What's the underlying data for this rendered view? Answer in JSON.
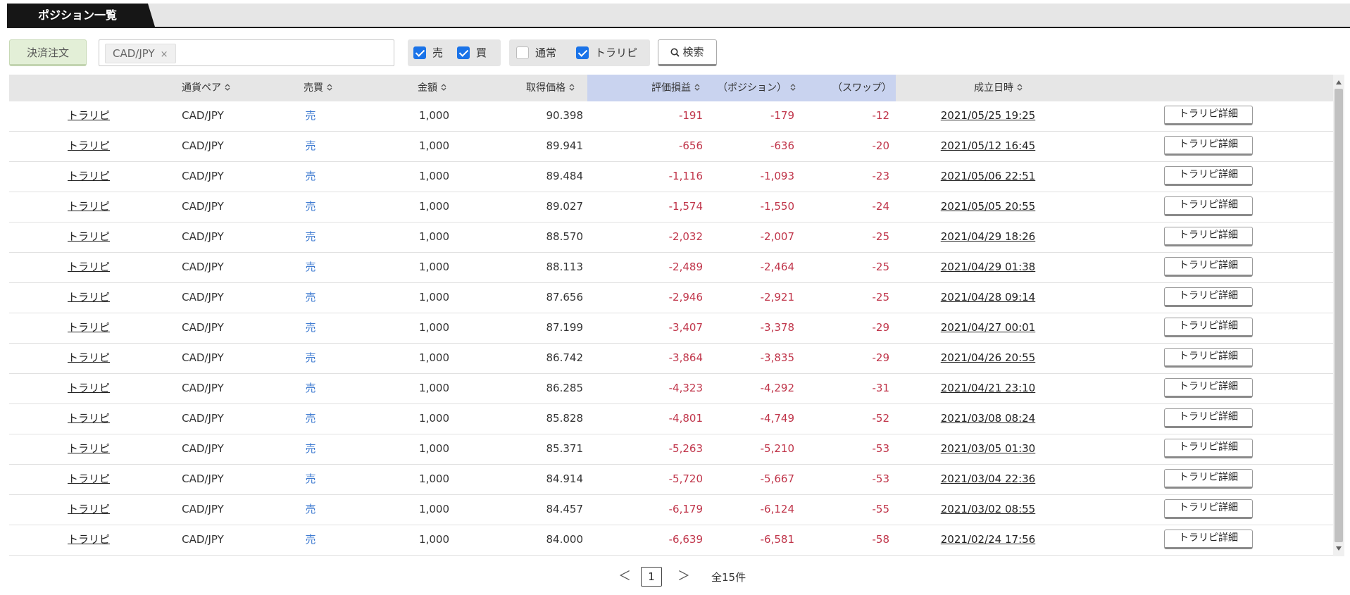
{
  "tab": {
    "title": "ポジション一覧"
  },
  "filters": {
    "settle_button": "決済注文",
    "pair_chip": "CAD/JPY",
    "chip_remove": "×",
    "side": [
      {
        "label": "売",
        "checked": true
      },
      {
        "label": "買",
        "checked": true
      }
    ],
    "order_type": [
      {
        "label": "通常",
        "checked": false
      },
      {
        "label": "トラリピ",
        "checked": true
      }
    ],
    "search_button": "検索"
  },
  "table": {
    "headers": {
      "pair": "通貨ペア",
      "side": "売買",
      "amount": "金額",
      "price": "取得価格",
      "pl": "評価損益",
      "position": "（ポジション）",
      "swap": "（スワップ）",
      "date": "成立日時"
    },
    "detail_button_label": "トラリピ詳細",
    "rows": [
      {
        "type": "トラリピ",
        "pair": "CAD/JPY",
        "side": "売",
        "amount": "1,000",
        "price": "90.398",
        "pl": "-191",
        "position": "-179",
        "swap": "-12",
        "date": "2021/05/25 19:25"
      },
      {
        "type": "トラリピ",
        "pair": "CAD/JPY",
        "side": "売",
        "amount": "1,000",
        "price": "89.941",
        "pl": "-656",
        "position": "-636",
        "swap": "-20",
        "date": "2021/05/12 16:45"
      },
      {
        "type": "トラリピ",
        "pair": "CAD/JPY",
        "side": "売",
        "amount": "1,000",
        "price": "89.484",
        "pl": "-1,116",
        "position": "-1,093",
        "swap": "-23",
        "date": "2021/05/06 22:51"
      },
      {
        "type": "トラリピ",
        "pair": "CAD/JPY",
        "side": "売",
        "amount": "1,000",
        "price": "89.027",
        "pl": "-1,574",
        "position": "-1,550",
        "swap": "-24",
        "date": "2021/05/05 20:55"
      },
      {
        "type": "トラリピ",
        "pair": "CAD/JPY",
        "side": "売",
        "amount": "1,000",
        "price": "88.570",
        "pl": "-2,032",
        "position": "-2,007",
        "swap": "-25",
        "date": "2021/04/29 18:26"
      },
      {
        "type": "トラリピ",
        "pair": "CAD/JPY",
        "side": "売",
        "amount": "1,000",
        "price": "88.113",
        "pl": "-2,489",
        "position": "-2,464",
        "swap": "-25",
        "date": "2021/04/29 01:38"
      },
      {
        "type": "トラリピ",
        "pair": "CAD/JPY",
        "side": "売",
        "amount": "1,000",
        "price": "87.656",
        "pl": "-2,946",
        "position": "-2,921",
        "swap": "-25",
        "date": "2021/04/28 09:14"
      },
      {
        "type": "トラリピ",
        "pair": "CAD/JPY",
        "side": "売",
        "amount": "1,000",
        "price": "87.199",
        "pl": "-3,407",
        "position": "-3,378",
        "swap": "-29",
        "date": "2021/04/27 00:01"
      },
      {
        "type": "トラリピ",
        "pair": "CAD/JPY",
        "side": "売",
        "amount": "1,000",
        "price": "86.742",
        "pl": "-3,864",
        "position": "-3,835",
        "swap": "-29",
        "date": "2021/04/26 20:55"
      },
      {
        "type": "トラリピ",
        "pair": "CAD/JPY",
        "side": "売",
        "amount": "1,000",
        "price": "86.285",
        "pl": "-4,323",
        "position": "-4,292",
        "swap": "-31",
        "date": "2021/04/21 23:10"
      },
      {
        "type": "トラリピ",
        "pair": "CAD/JPY",
        "side": "売",
        "amount": "1,000",
        "price": "85.828",
        "pl": "-4,801",
        "position": "-4,749",
        "swap": "-52",
        "date": "2021/03/08 08:24"
      },
      {
        "type": "トラリピ",
        "pair": "CAD/JPY",
        "side": "売",
        "amount": "1,000",
        "price": "85.371",
        "pl": "-5,263",
        "position": "-5,210",
        "swap": "-53",
        "date": "2021/03/05 01:30"
      },
      {
        "type": "トラリピ",
        "pair": "CAD/JPY",
        "side": "売",
        "amount": "1,000",
        "price": "84.914",
        "pl": "-5,720",
        "position": "-5,667",
        "swap": "-53",
        "date": "2021/03/04 22:36"
      },
      {
        "type": "トラリピ",
        "pair": "CAD/JPY",
        "side": "売",
        "amount": "1,000",
        "price": "84.457",
        "pl": "-6,179",
        "position": "-6,124",
        "swap": "-55",
        "date": "2021/03/02 08:55"
      },
      {
        "type": "トラリピ",
        "pair": "CAD/JPY",
        "side": "売",
        "amount": "1,000",
        "price": "84.000",
        "pl": "-6,639",
        "position": "-6,581",
        "swap": "-58",
        "date": "2021/02/24 17:56"
      }
    ]
  },
  "pagination": {
    "prev": "＜",
    "current": "1",
    "next": "＞",
    "total": "全15件"
  },
  "icons": {
    "search": "search-icon",
    "sort": "sort-icon",
    "check": "check-icon"
  },
  "colors": {
    "tab_bg": "#161616",
    "settle_button_bg": "#e3efd7",
    "checkbox_on": "#1a73e8",
    "highlight_header": "#c9d3ef",
    "negative": "#c0354a",
    "sell": "#3f7bd1"
  }
}
